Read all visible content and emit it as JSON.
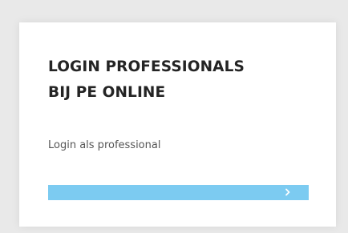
{
  "card": {
    "title_line1": "LOGIN PROFESSIONALS",
    "title_line2": "BIJ PE ONLINE",
    "description": "Login als professional",
    "button_icon": "chevron-right-icon",
    "button_color": "#7ccbf1"
  }
}
